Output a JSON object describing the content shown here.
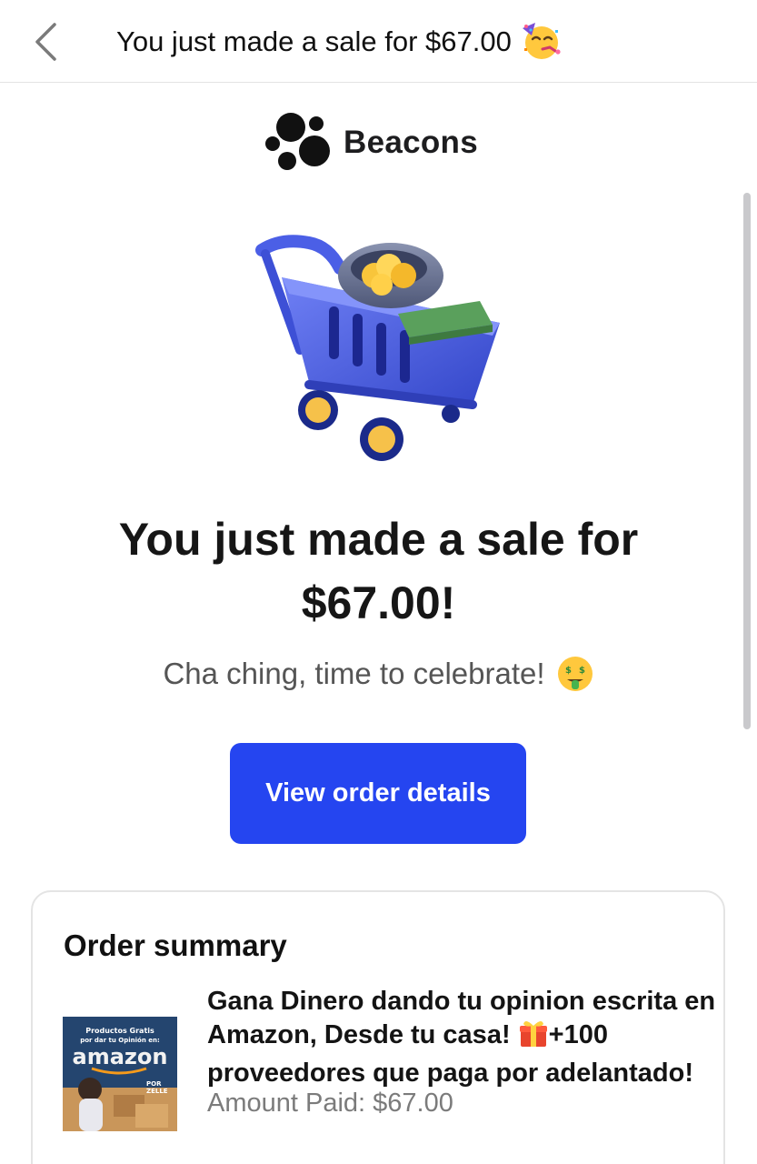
{
  "header": {
    "subject": "You just made a sale for $67.00",
    "subject_emoji": "partying-face"
  },
  "brand": {
    "name": "Beacons"
  },
  "hero": {
    "illustration": "shopping-cart-with-money",
    "headline": "You just made a sale for $67.00!",
    "subline": "Cha ching, time to celebrate!",
    "subline_emoji": "money-mouth-face"
  },
  "cta": {
    "label": "View order details"
  },
  "order_summary": {
    "title": "Order summary",
    "product": {
      "name_before_emoji": "Gana Dinero dando tu opinion escrita en Amazon, Desde tu casa! ",
      "name_emoji": "gift",
      "name_after_emoji": "+100 proveedores que paga por adelantado!",
      "amount_paid": "Amount Paid: $67.00",
      "thumbnail": {
        "line1": "Productos Gratis",
        "line2": "por dar tu Opinión en:",
        "logo": "amazon",
        "tag1": "POR",
        "tag2": "ZELLE"
      }
    }
  },
  "colors": {
    "accent": "#2545f0",
    "cart": "#4a5ee0",
    "wheel": "#f6c14a"
  }
}
